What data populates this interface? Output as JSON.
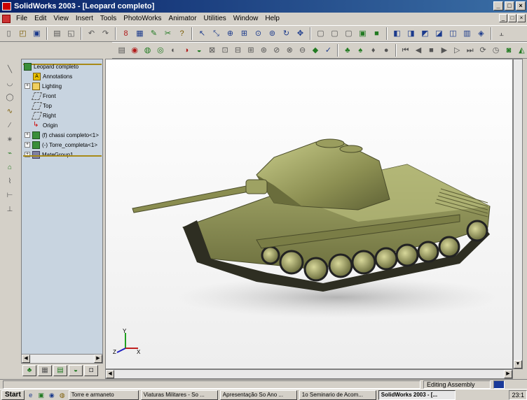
{
  "window": {
    "title": "SolidWorks 2003 - [Leopard completo]"
  },
  "menu": [
    "File",
    "Edit",
    "View",
    "Insert",
    "Tools",
    "PhotoWorks",
    "Animator",
    "Utilities",
    "Window",
    "Help"
  ],
  "feature_tree": {
    "root": "Leopard completo",
    "items": [
      "Annotations",
      "Lighting",
      "Front",
      "Top",
      "Right",
      "Origin",
      "(f) chassi completo<1>",
      "(-) Torre_completa<1>",
      "MateGroup1"
    ]
  },
  "triad": {
    "x": "X",
    "y": "Y",
    "z": "Z"
  },
  "status": {
    "mode": "Editing Assembly"
  },
  "taskbar": {
    "start": "Start",
    "items": [
      "Torre e armaneto",
      "Viaturas Militares - So ...",
      "Apresentação So Ano ...",
      "1o Seminario de Acom...",
      "SolidWorks 2003 - [..."
    ],
    "clock": "23:1"
  }
}
